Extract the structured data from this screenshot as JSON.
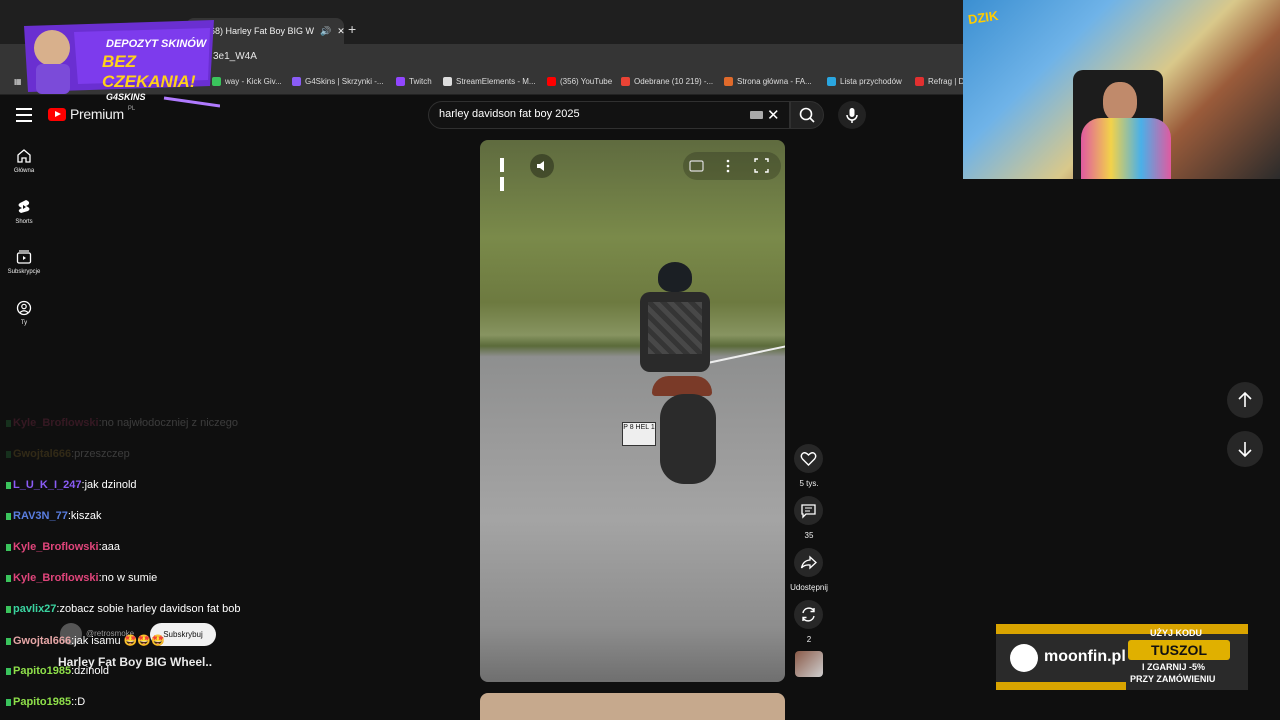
{
  "browser": {
    "active_tab_title": "(168) Harley Fat Boy BIG W",
    "url_fragment": "3e1_W4A",
    "new_tab_label": "+",
    "bookmarks": [
      {
        "label": "way - Kick Giv...",
        "color": "#3ac45c"
      },
      {
        "label": "G4Skins | Skrzynki -...",
        "color": "#8a5cf6"
      },
      {
        "label": "Twitch",
        "color": "#9146ff"
      },
      {
        "label": "StreamElements - M...",
        "color": "#dddddd"
      },
      {
        "label": "(356) YouTube",
        "color": "#ff0000"
      },
      {
        "label": "Odebrane (10 219) -...",
        "color": "#ea4335"
      },
      {
        "label": "Strona główna - FA...",
        "color": "#e06a2b"
      },
      {
        "label": "Lista przychodów",
        "color": "#2aa6e0"
      },
      {
        "label": "Refrag | D",
        "color": "#e23030"
      }
    ]
  },
  "youtube": {
    "logo_text": "Premium",
    "logo_region": "PL",
    "search_value": "harley davidson fat boy 2025",
    "guide": [
      {
        "label": "Główna",
        "icon": "home-icon"
      },
      {
        "label": "Shorts",
        "icon": "shorts-icon"
      },
      {
        "label": "Subskrypcje",
        "icon": "subscriptions-icon"
      },
      {
        "label": "Ty",
        "icon": "you-icon"
      }
    ],
    "short": {
      "plate_text": "P 8 HEL 1",
      "likes": "5 tys.",
      "comments": "35",
      "share_label": "Udostępnij",
      "remix_count": "2",
      "title": "Harley Fat Boy BIG Wheel..",
      "channel": "@retrosmoke",
      "subscribe_label": "Subskrybuj"
    }
  },
  "overlays": {
    "promo_line1": "DEPOZYT SKINÓW",
    "promo_line2": "BEZ CZEKANIA!",
    "promo_brand": "G4SKINS",
    "cam_brand": "DZIK",
    "moonfin_brand": "moonfin.pl",
    "moonfin_code_label": "UŻYJ KODU",
    "moonfin_code": "TUSZOL",
    "moonfin_offer1": "I ZGARNIJ -5%",
    "moonfin_offer2": "PRZY ZAMÓWIENIU"
  },
  "chat": [
    {
      "user": "Kyle_Broflowski",
      "msg": "no najwłodoczniej z niczego",
      "color": "#e0457b",
      "faded": true
    },
    {
      "user": "Gwojtal666",
      "msg": "przeszczep",
      "color": "#caa23a",
      "faded": true
    },
    {
      "user": "L_U_K_I_247",
      "msg": "jak dzinold",
      "color": "#8a5cf6"
    },
    {
      "user": "RAV3N_77",
      "msg": "kiszak",
      "color": "#5a7ee0"
    },
    {
      "user": "Kyle_Broflowski",
      "msg": "aaa",
      "color": "#e0457b"
    },
    {
      "user": "Kyle_Broflowski",
      "msg": "no w sumie",
      "color": "#e0457b"
    },
    {
      "user": "pavlix27",
      "msg": "zobacz sobie harley davidson fat bob",
      "color": "#3ad3a0"
    },
    {
      "user": "Gwojtal666",
      "msg": "jak isamu 🤩🤩🤩",
      "color": "#e6a7a7"
    },
    {
      "user": "Papito1985",
      "msg": "dzinold",
      "color": "#8fe04a"
    },
    {
      "user": "Papito1985",
      "msg": ":D",
      "color": "#8fe04a"
    }
  ]
}
